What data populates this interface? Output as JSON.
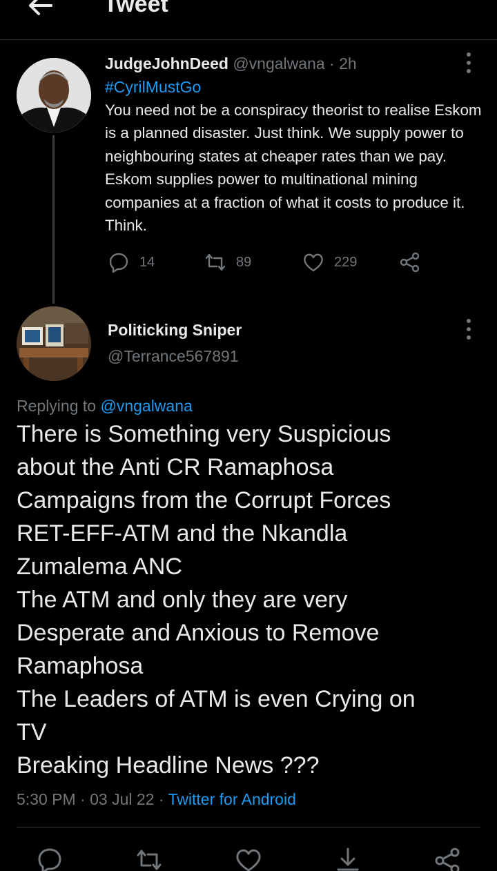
{
  "header": {
    "title": "Tweet",
    "back_icon": "back-arrow-icon"
  },
  "parent_tweet": {
    "display_name": "JudgeJohnDeed",
    "handle": "@vngalwana",
    "separator": "·",
    "time": "2h",
    "hashtag": "#CyrilMustGo",
    "body": "You need not be a conspiracy theorist to realise Eskom is a planned disaster. Just think. We supply power to neighbouring states at cheaper rates than we pay. Eskom supplies power to multinational mining companies at a fraction of what it costs to produce it. Think.",
    "replies": "14",
    "retweets": "89",
    "likes": "229"
  },
  "main_tweet": {
    "display_name": "Politicking Sniper",
    "handle": "@Terrance567891",
    "replying_prefix": "Replying to",
    "replying_handle": "@vngalwana",
    "body_lines": [
      "There is Something very Suspicious",
      "about the Anti CR Ramaphosa",
      "Campaigns from the Corrupt Forces",
      "RET-EFF-ATM and the Nkandla",
      "Zumalema ANC",
      "The ATM and only they are very",
      "Desperate and Anxious to Remove",
      "Ramaphosa",
      "The Leaders of ATM is even Crying on",
      "TV",
      "Breaking Headline News ???"
    ],
    "time": "5:30 PM",
    "separator": "·",
    "date": "03 Jul 22",
    "separator2": "·",
    "source": "Twitter for Android"
  },
  "colors": {
    "background": "#000000",
    "text": "#e7e9ea",
    "muted": "#71767b",
    "accent": "#1d9bf0",
    "divider": "#2f3336"
  }
}
